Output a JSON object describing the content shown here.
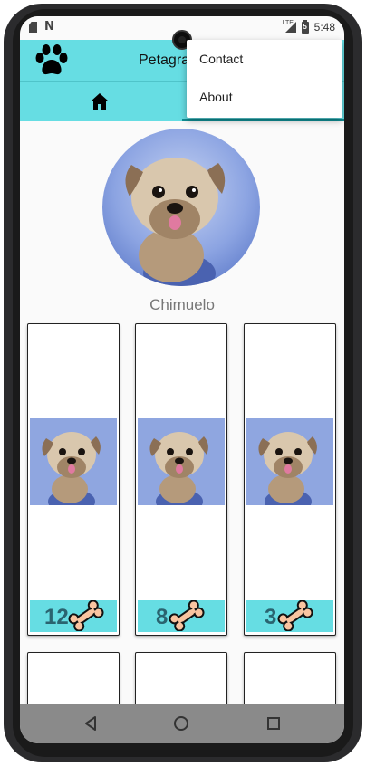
{
  "status_bar": {
    "time": "5:48",
    "network_label": "LTE",
    "battery_label": "5",
    "icons": [
      "sim-icon",
      "n-notification-icon",
      "signal-icon",
      "battery-icon"
    ]
  },
  "toolbar": {
    "title": "Petagram",
    "logo_icon": "paw-icon",
    "background_color": "#66dde3"
  },
  "tabs": [
    {
      "icon": "home-icon",
      "selected": false
    },
    {
      "icon": "",
      "selected": true
    }
  ],
  "overflow_menu": {
    "items": [
      {
        "label": "Contact"
      },
      {
        "label": "About"
      }
    ]
  },
  "profile": {
    "pet_name": "Chimuelo"
  },
  "photos": [
    {
      "likes": "12",
      "icon": "bone-icon"
    },
    {
      "likes": "8",
      "icon": "bone-icon"
    },
    {
      "likes": "3",
      "icon": "bone-icon"
    }
  ],
  "colors": {
    "accent": "#66dde3",
    "rating_text": "#2a6470",
    "tab_indicator": "#0f8f95"
  },
  "nav_bar": {
    "icons": [
      "back-icon",
      "home-circle-icon",
      "recents-icon"
    ]
  }
}
